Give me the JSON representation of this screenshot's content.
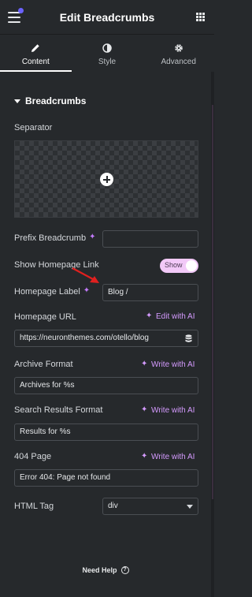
{
  "header": {
    "title": "Edit Breadcrumbs"
  },
  "tabs": [
    {
      "label": "Content",
      "icon": "pencil-icon",
      "active": true
    },
    {
      "label": "Style",
      "icon": "half-circle-icon",
      "active": false
    },
    {
      "label": "Advanced",
      "icon": "gear-icon",
      "active": false
    }
  ],
  "section": {
    "title": "Breadcrumbs"
  },
  "fields": {
    "separator": {
      "label": "Separator"
    },
    "prefix": {
      "label": "Prefix Breadcrumb",
      "value": ""
    },
    "show_home": {
      "label": "Show Homepage Link",
      "toggle_text": "Show",
      "on": true
    },
    "home_label": {
      "label": "Homepage Label",
      "value": "Blog /"
    },
    "home_url": {
      "label": "Homepage URL",
      "ai_label": "Edit with AI",
      "value": "https://neuronthemes.com/otello/blog"
    },
    "archive": {
      "label": "Archive Format",
      "ai_label": "Write with AI",
      "value": "Archives for %s"
    },
    "search": {
      "label": "Search Results Format",
      "ai_label": "Write with AI",
      "value": "Results for %s"
    },
    "p404": {
      "label": "404 Page",
      "ai_label": "Write with AI",
      "value": "Error 404: Page not found"
    },
    "html_tag": {
      "label": "HTML Tag",
      "value": "div"
    }
  },
  "footer": {
    "help": "Need Help"
  },
  "colors": {
    "accent_ai": "#d59bff",
    "toggle_bg": "#f2c9f8",
    "arrow": "#e0201f"
  }
}
